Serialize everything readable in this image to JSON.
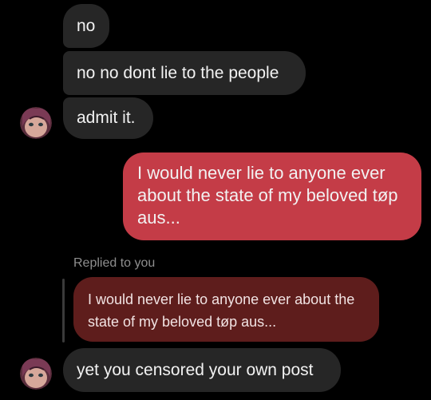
{
  "messages": {
    "m1": "no",
    "m2": "no no dont lie to the people",
    "m3": "admit it.",
    "sent": "I would never lie to anyone ever about the state of my beloved tøp aus...",
    "reply_label": "Replied to you",
    "quoted": "I would never lie to anyone ever about the state of my beloved tøp aus...",
    "m5": "yet you censored your own post"
  },
  "colors": {
    "incoming_bubble": "#262626",
    "outgoing_bubble": "#c43c47",
    "quoted_bubble": "#5e1d1c",
    "background": "#000000"
  },
  "icons": {
    "avatar": "user-avatar-icon"
  }
}
